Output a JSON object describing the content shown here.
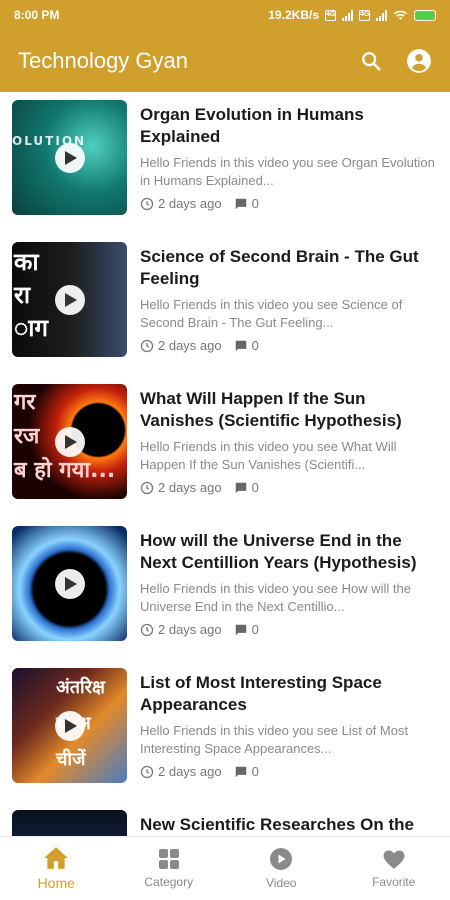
{
  "status": {
    "time": "8:00 PM",
    "speed": "19.2KB/s"
  },
  "colors": {
    "accent": "#d1a02c",
    "active_nav": "#d1a02c",
    "muted": "#8a8a8a"
  },
  "app_bar": {
    "title": "Technology Gyan",
    "search_icon": "search-icon",
    "account_icon": "account-icon"
  },
  "videos": [
    {
      "title": "Organ Evolution in Humans Explained",
      "description": "Hello Friends in this video you see Organ Evolution in Humans Explained...",
      "time": "2 days ago",
      "comments": "0",
      "thumb_text": "OLUTION"
    },
    {
      "title": "Science of Second Brain - The Gut Feeling",
      "description": "Hello Friends in this video you see Science of Second Brain - The Gut Feeling...",
      "time": "2 days ago",
      "comments": "0",
      "thumb_text": "का\nरा\nाग"
    },
    {
      "title": "What Will Happen If the Sun Vanishes (Scientific Hypothesis)",
      "description": "Hello Friends in this video you see What Will Happen If the Sun Vanishes (Scientifi...",
      "time": "2 days ago",
      "comments": "0",
      "thumb_text": "गर\nरज\nब हो गया..."
    },
    {
      "title": "How will the Universe End in the Next Centillion Years (Hypothesis)",
      "description": "Hello Friends in this video you see How will the Universe End in the Next Centillio...",
      "time": "2 days ago",
      "comments": "0",
      "thumb_text": ""
    },
    {
      "title": "List of Most Interesting Space Appearances",
      "description": "Hello Friends in this video you see List of Most Interesting Space Appearances...",
      "time": "2 days ago",
      "comments": "0",
      "thumb_text": "अंतरिक्ष\nखे अ\nचीजें"
    },
    {
      "title": "New Scientific Researches On the",
      "description": "",
      "time": "",
      "comments": "",
      "thumb_text": ""
    }
  ],
  "bottom_nav": [
    {
      "label": "Home",
      "icon": "home-icon",
      "active": true
    },
    {
      "label": "Category",
      "icon": "category-icon",
      "active": false
    },
    {
      "label": "Video",
      "icon": "video-icon",
      "active": false
    },
    {
      "label": "Favorite",
      "icon": "heart-icon",
      "active": false
    }
  ]
}
